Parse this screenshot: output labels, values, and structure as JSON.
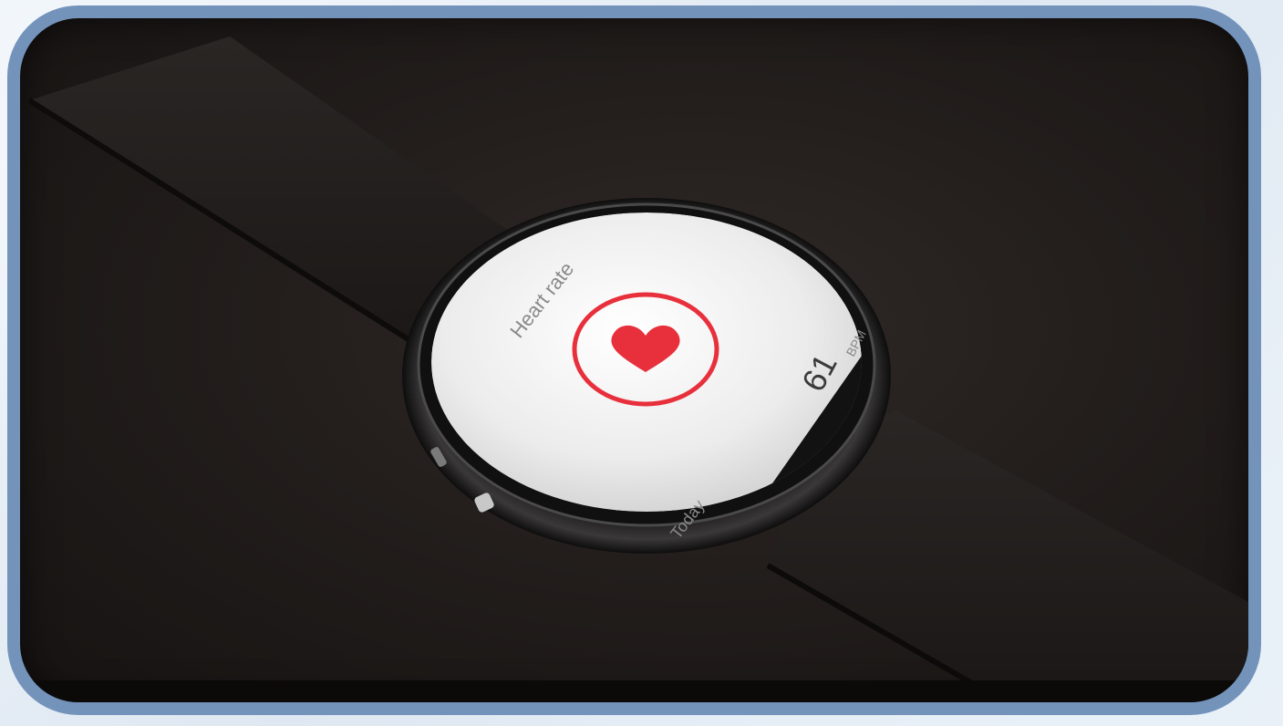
{
  "watch_screen": {
    "title": "Heart rate",
    "bpm_value": "61",
    "bpm_unit": "BPM",
    "period_label": "Today"
  },
  "colors": {
    "frame_border": "#7393bb",
    "accent_red": "#e8303c",
    "screen_white": "#f2f2f2"
  },
  "icons": {
    "heart": "heart-icon",
    "ring": "heart-ring-icon"
  }
}
